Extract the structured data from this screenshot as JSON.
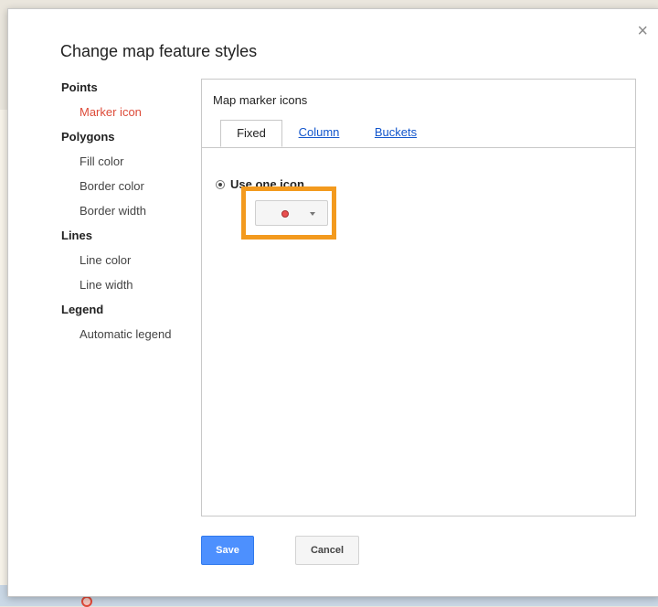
{
  "dialog": {
    "title": "Change map feature styles",
    "close_glyph": "×"
  },
  "nav": {
    "points": "Points",
    "marker_icon": "Marker icon",
    "polygons": "Polygons",
    "fill_color": "Fill color",
    "border_color": "Border color",
    "border_width": "Border width",
    "lines": "Lines",
    "line_color": "Line color",
    "line_width": "Line width",
    "legend": "Legend",
    "automatic_legend": "Automatic legend"
  },
  "panel": {
    "title": "Map marker icons",
    "tabs": [
      {
        "label": "Fixed",
        "active": true
      },
      {
        "label": "Column",
        "active": false
      },
      {
        "label": "Buckets",
        "active": false
      }
    ],
    "option_label": "Use one icon",
    "selected_icon": "red-dot-icon"
  },
  "buttons": {
    "save": "Save",
    "cancel": "Cancel"
  },
  "colors": {
    "accent": "#4d90fe",
    "selected_nav": "#dd4b39",
    "highlight": "#f39a1e",
    "marker": "#e94f4f"
  }
}
